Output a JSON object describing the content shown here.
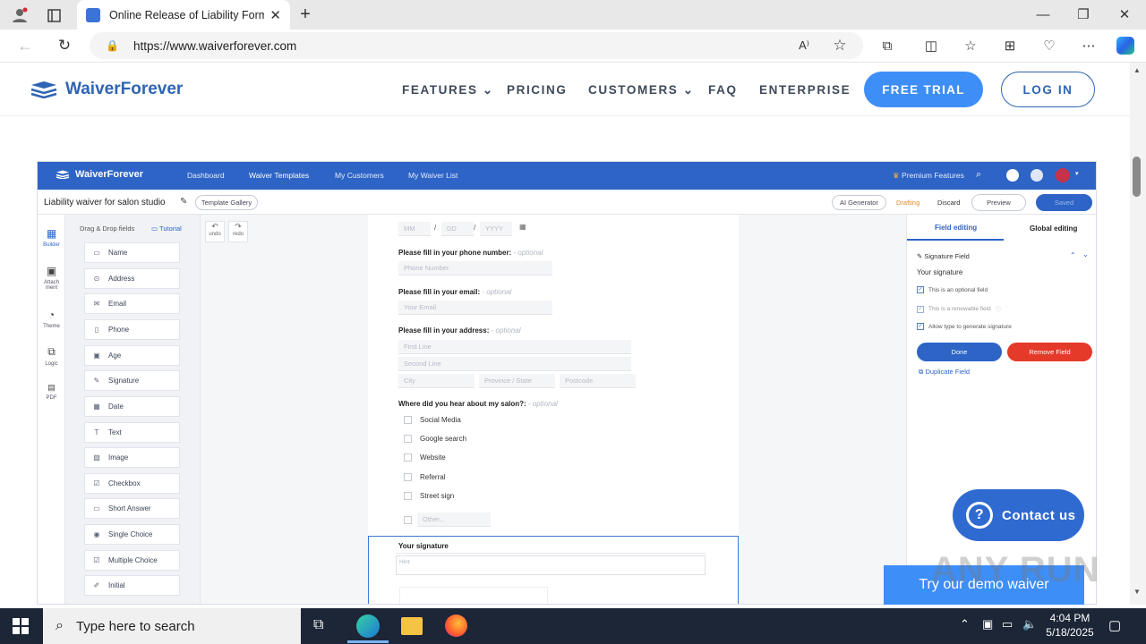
{
  "browser": {
    "tab_title": "Online Release of Liability Forms",
    "url": "https://www.waiverforever.com"
  },
  "site": {
    "logo_text": "WaiverForever",
    "nav": [
      {
        "label": "FEATURES",
        "has_dropdown": true
      },
      {
        "label": "PRICING",
        "has_dropdown": false
      },
      {
        "label": "CUSTOMERS",
        "has_dropdown": true
      },
      {
        "label": "FAQ",
        "has_dropdown": false
      },
      {
        "label": "ENTERPRISE",
        "has_dropdown": false
      }
    ],
    "free_trial": "FREE TRIAL",
    "login": "LOG IN",
    "contact_us": "Contact us",
    "demo_button": "Try our demo waiver",
    "watermark": "ANY RUN"
  },
  "app": {
    "logo": "WaiverForever",
    "nav": [
      "Dashboard",
      "Waiver Templates",
      "My Customers",
      "My Waiver List"
    ],
    "premium": "Premium Features",
    "title": "Liability waiver for salon studio",
    "template_gallery": "Template Gallery",
    "ai_generator": "AI Generator",
    "drafting": "Drafting",
    "discard": "Discard",
    "preview": "Preview",
    "saved": "Saved",
    "rail": [
      "Builder",
      "Attach ment",
      "Theme",
      "Logic",
      "PDF"
    ],
    "panel_title": "Drag & Drop fields",
    "tutorial": "Tutorial",
    "undo": "undo",
    "redo": "redo",
    "fields": [
      "Name",
      "Address",
      "Email",
      "Phone",
      "Age",
      "Signature",
      "Date",
      "Text",
      "Image",
      "Checkbox",
      "Short Answer",
      "Single Choice",
      "Multiple Choice",
      "Initial"
    ],
    "form": {
      "dob_mm": "MM",
      "dob_dd": "DD",
      "dob_yyyy": "YYYY",
      "phone_q": "Please fill in your phone number:",
      "optional": "- optional",
      "phone_ph": "Phone Number",
      "email_q": "Please fill in your email:",
      "email_ph": "Your Email",
      "address_q": "Please fill in your address:",
      "addr_line1": "First Line",
      "addr_line2": "Second Line",
      "city": "City",
      "province": "Province / State",
      "postcode": "Postcode",
      "hear_q": "Where did you hear about my salon?:",
      "options": [
        "Social Media",
        "Google search",
        "Website",
        "Referral",
        "Street sign"
      ],
      "other": "Other...",
      "signature_label": "Your signature",
      "signature_ph": "Hint"
    },
    "right": {
      "tab_field": "Field editing",
      "tab_global": "Global editing",
      "field_type": "Signature Field",
      "field_label": "Your signature",
      "opt1": "This is an optional field",
      "opt2": "This is a renewable field",
      "opt3": "Allow type to generate signature",
      "done": "Done",
      "remove": "Remove Field",
      "duplicate": "Duplicate Field"
    }
  },
  "taskbar": {
    "search_placeholder": "Type here to search",
    "time": "4:04 PM",
    "date": "5/18/2025"
  },
  "colors": {
    "brand": "#2d64c6",
    "accent": "#3e8ef7",
    "remove": "#e53a2a"
  }
}
